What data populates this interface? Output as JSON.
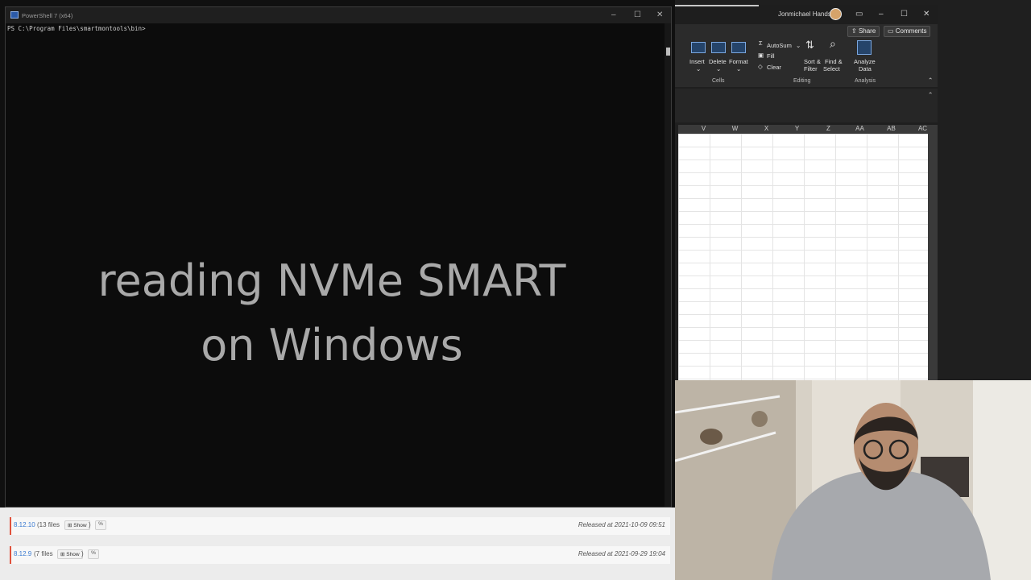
{
  "powershell": {
    "window_title": "PowerShell 7 (x64)",
    "prompt": "PS C:\\Program Files\\smartmontools\\bin>",
    "controls": {
      "minimize": "–",
      "maximize": "☐",
      "close": "✕"
    }
  },
  "overlay": {
    "line1": "reading NVMe SMART",
    "line2": "on Windows"
  },
  "excel": {
    "user_name": "Jonmichael Hands",
    "share_label": "Share",
    "comments_label": "Comments",
    "cells": {
      "insert": "Insert",
      "delete": "Delete",
      "format": "Format",
      "group": "Cells"
    },
    "editing": {
      "autosum": "AutoSum",
      "fill": "Fill",
      "clear": "Clear",
      "sort_filter_1": "Sort &",
      "sort_filter_2": "Filter",
      "find_select_1": "Find &",
      "find_select_2": "Select",
      "group": "Editing"
    },
    "analysis": {
      "analyze_1": "Analyze",
      "analyze_2": "Data",
      "group": "Analysis"
    },
    "columns": [
      "V",
      "W",
      "X",
      "Y",
      "Z",
      "AA",
      "AB",
      "AC"
    ]
  },
  "releases": [
    {
      "version": "8.12.10",
      "files": "(13 files",
      "show": "Show",
      "close_paren": ")",
      "link": "%",
      "date": "Released at 2021-10-09 09:51"
    },
    {
      "version": "8.12.9",
      "files": "(7 files",
      "show": "Show",
      "close_paren": ")",
      "link": "%",
      "date": "Released at 2021-09-29 19:04"
    }
  ]
}
